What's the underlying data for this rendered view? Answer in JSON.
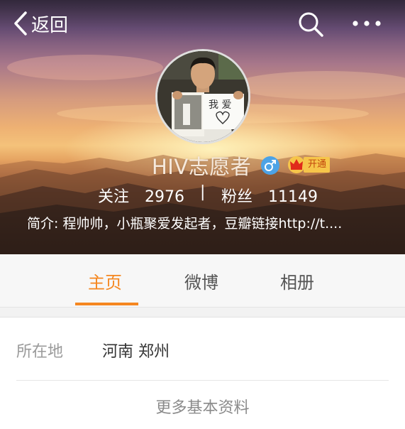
{
  "colors": {
    "accent": "#f58720",
    "vip_bg": "#f6c54a",
    "vip_text": "#c2470d",
    "gender_male": "#4da3e6"
  },
  "header": {
    "back_label": "返回",
    "back_icon": "chevron-left-icon",
    "search_icon": "search-icon",
    "more_icon": "more-dots-icon"
  },
  "profile": {
    "name": "HIV志愿者",
    "gender_icon": "male-icon",
    "vip_label": "开通",
    "vip_icon": "crown-icon",
    "following_label": "关注",
    "following_count": "2976",
    "separator": "|",
    "followers_label": "粉丝",
    "followers_count": "11149",
    "bio": "简介: 程帅帅，小瓶聚爱发起者，豆瓣链接http://t...."
  },
  "tabs": [
    {
      "label": "主页",
      "active": true
    },
    {
      "label": "微博",
      "active": false
    },
    {
      "label": "相册",
      "active": false
    }
  ],
  "info": {
    "location_label": "所在地",
    "location_value": "河南 郑州",
    "more_label": "更多基本资料"
  }
}
